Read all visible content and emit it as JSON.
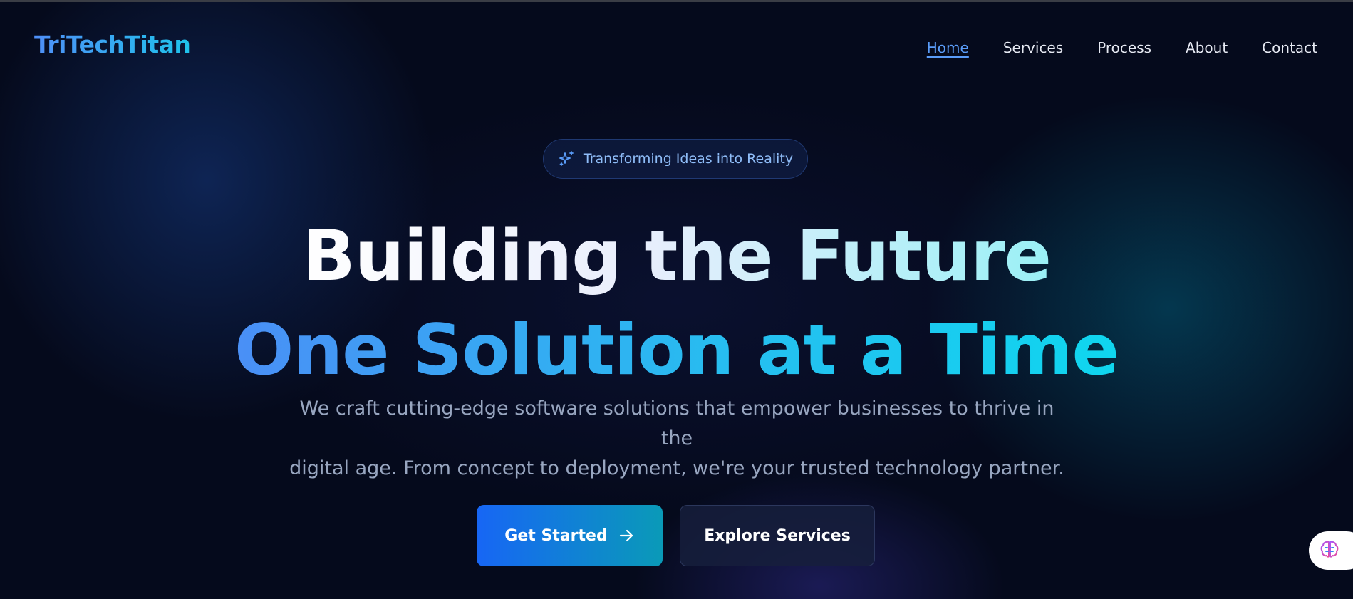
{
  "brand": {
    "logo_text": "TriTechTitan",
    "gradient_start": "#4f8ff7",
    "gradient_end": "#1fc3ec"
  },
  "nav": {
    "items": [
      {
        "label": "Home",
        "active": true
      },
      {
        "label": "Services",
        "active": false
      },
      {
        "label": "Process",
        "active": false
      },
      {
        "label": "About",
        "active": false
      },
      {
        "label": "Contact",
        "active": false
      }
    ],
    "active_color": "#5a9cf8"
  },
  "hero": {
    "badge": {
      "icon": "sparkles-icon",
      "text": "Transforming Ideas into Reality"
    },
    "headline_line1": "Building the Future",
    "headline_line2": "One Solution at a Time",
    "subtitle_line1": "We craft cutting-edge software solutions that empower businesses to thrive in the",
    "subtitle_line2": "digital age. From concept to deployment, we're your trusted technology partner.",
    "primary_button": {
      "label": "Get Started",
      "icon": "arrow-right-icon"
    },
    "secondary_button": {
      "label": "Explore Services"
    }
  },
  "widget": {
    "icon": "brain-icon"
  },
  "colors": {
    "background": "#050a1c",
    "primary_button_start": "#1766f5",
    "primary_button_end": "#0a9ab8",
    "subtitle": "#98a6c0"
  }
}
